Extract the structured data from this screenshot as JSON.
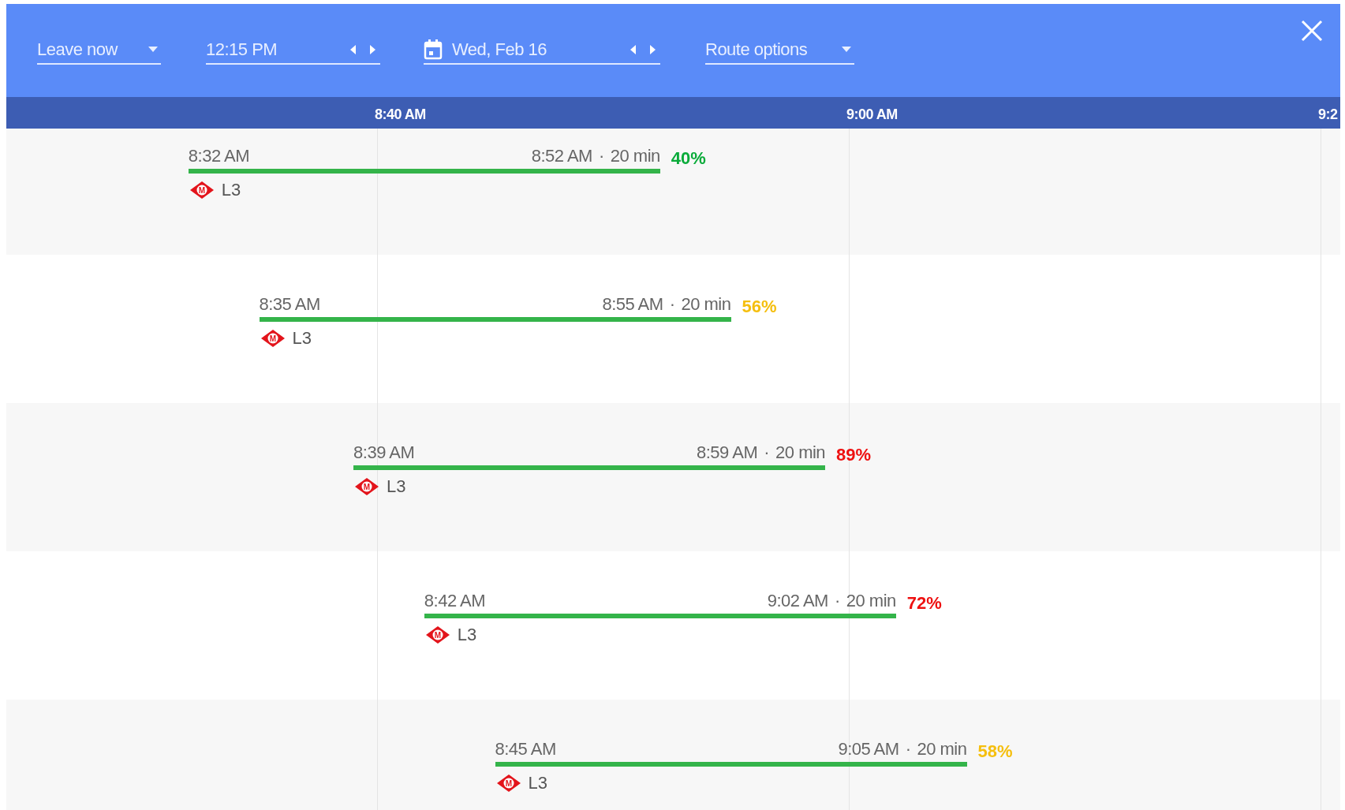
{
  "toolbar": {
    "departure_mode": "Leave now",
    "time": "12:15 PM",
    "date": "Wed, Feb 16",
    "route_options": "Route options"
  },
  "timeline": {
    "ticks": [
      "8:40 AM",
      "9:00 AM",
      "9:2"
    ]
  },
  "trips": [
    {
      "depart": "8:32 AM",
      "arrive": "8:52 AM",
      "separator": "·",
      "duration": "20 min",
      "occupancy": "40%",
      "color": "#0aab3a",
      "badge_letter": "M",
      "line": "L3"
    },
    {
      "depart": "8:35 AM",
      "arrive": "8:55 AM",
      "separator": "·",
      "duration": "20 min",
      "occupancy": "56%",
      "color": "#f5bf0f",
      "badge_letter": "M",
      "line": "L3"
    },
    {
      "depart": "8:39 AM",
      "arrive": "8:59 AM",
      "separator": "·",
      "duration": "20 min",
      "occupancy": "89%",
      "color": "#ee1111",
      "badge_letter": "M",
      "line": "L3"
    },
    {
      "depart": "8:42 AM",
      "arrive": "9:02 AM",
      "separator": "·",
      "duration": "20 min",
      "occupancy": "72%",
      "color": "#ee1111",
      "badge_letter": "M",
      "line": "L3"
    },
    {
      "depart": "8:45 AM",
      "arrive": "9:05 AM",
      "separator": "·",
      "duration": "20 min",
      "occupancy": "58%",
      "color": "#f5bf0f",
      "badge_letter": "M",
      "line": "L3"
    }
  ]
}
